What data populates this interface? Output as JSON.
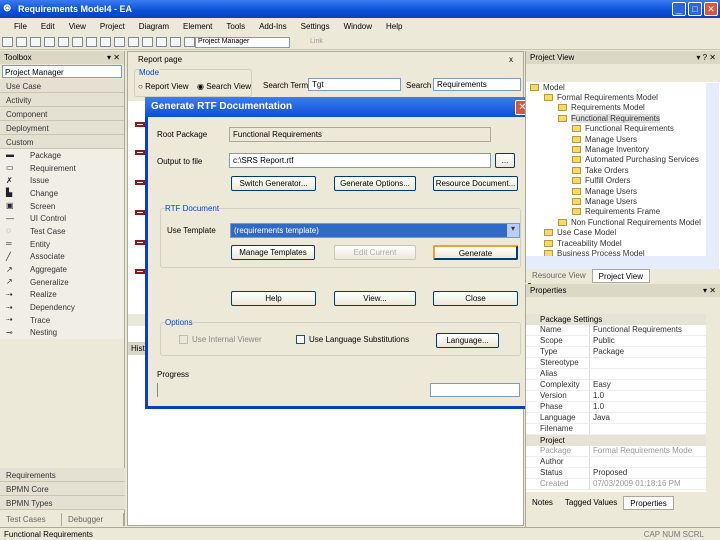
{
  "window": {
    "title": "Requirements Model4 - EA",
    "minimize": "_",
    "maximize": "□",
    "close": "✕"
  },
  "menu": [
    "File",
    "Edit",
    "View",
    "Project",
    "Diagram",
    "Element",
    "Tools",
    "Add-Ins",
    "Settings",
    "Window",
    "Help"
  ],
  "toolbar": {
    "perspective": "Project Manager",
    "link": "Link"
  },
  "toolbox": {
    "title": "Toolbox",
    "selector": "Project Manager",
    "categories": [
      "Use Case",
      "Activity",
      "Component",
      "Deployment",
      "Custom"
    ],
    "tools": [
      {
        "icon": "package-icon",
        "g": "▬",
        "label": "Package"
      },
      {
        "icon": "requirement-icon",
        "g": "▭",
        "label": "Requirement"
      },
      {
        "icon": "issue-icon",
        "g": "✗",
        "label": "Issue"
      },
      {
        "icon": "change-icon",
        "g": "▙",
        "label": "Change"
      },
      {
        "icon": "screen-icon",
        "g": "▣",
        "label": "Screen"
      },
      {
        "icon": "ui-control-icon",
        "g": "—",
        "label": "UI Control"
      },
      {
        "icon": "test-case-icon",
        "g": "◌",
        "label": "Test Case"
      },
      {
        "icon": "entity-icon",
        "g": "═",
        "label": "Entity"
      },
      {
        "icon": "associate-icon",
        "g": "╱",
        "label": "Associate"
      },
      {
        "icon": "aggregate-icon",
        "g": "↗",
        "label": "Aggregate"
      },
      {
        "icon": "generalize-icon",
        "g": "↗",
        "label": "Generalize"
      },
      {
        "icon": "realize-icon",
        "g": "⇢",
        "label": "Realize"
      },
      {
        "icon": "dependency-icon",
        "g": "⇢",
        "label": "Dependency"
      },
      {
        "icon": "trace-icon",
        "g": "⇢",
        "label": "Trace"
      },
      {
        "icon": "nesting-icon",
        "g": "⊸",
        "label": "Nesting"
      }
    ],
    "bottom_categories": [
      "Requirements",
      "BPMN Core",
      "BPMN Types"
    ],
    "tabs": [
      "Test Cases",
      "Debugger"
    ]
  },
  "report": {
    "tab": "Report page",
    "mode_label": "Mode",
    "report_view": "Report View",
    "search_view": "Search View",
    "search_term_label": "Search Term",
    "search_term": "Tgt",
    "search_label": "Search",
    "search_value": "Requirements",
    "history": "History"
  },
  "dialog": {
    "title": "Generate RTF Documentation",
    "root_label": "Root Package",
    "root_value": "Functional Requirements",
    "output_label": "Output to file",
    "output_value": "c:\\SRS Report.rtf",
    "browse": "...",
    "switch_gen": "Switch Generator...",
    "gen_options": "Generate Options...",
    "resource_doc": "Resource Document...",
    "rtf_group": "RTF Document",
    "template_label": "Use Template",
    "template_value": "(requirements template)",
    "manage_templates": "Manage Templates",
    "edit_current": "Edit Current",
    "generate": "Generate",
    "help": "Help",
    "view": "View...",
    "close": "Close",
    "options_group": "Options",
    "internal_viewer": "Use Internal Viewer",
    "lang_sub": "Use Language Substitutions",
    "language": "Language...",
    "progress": "Progress"
  },
  "project_view": {
    "title": "Project View",
    "tree": [
      {
        "d": 0,
        "t": "Model"
      },
      {
        "d": 1,
        "t": "Formal Requirements Model"
      },
      {
        "d": 2,
        "t": "Requirements Model"
      },
      {
        "d": 2,
        "t": "Functional Requirements",
        "sel": true
      },
      {
        "d": 3,
        "t": "Functional Requirements"
      },
      {
        "d": 3,
        "t": "Manage Users"
      },
      {
        "d": 3,
        "t": "Manage Inventory"
      },
      {
        "d": 3,
        "t": "Automated Purchasing Services"
      },
      {
        "d": 3,
        "t": "Take Orders"
      },
      {
        "d": 3,
        "t": "Fulfill Orders"
      },
      {
        "d": 3,
        "t": "Manage Users"
      },
      {
        "d": 3,
        "t": "Manage Users"
      },
      {
        "d": 3,
        "t": "Requirements Frame"
      },
      {
        "d": 2,
        "t": "Non Functional Requirements Model"
      },
      {
        "d": 1,
        "t": "Use Case Model"
      },
      {
        "d": 1,
        "t": "Traceability Model"
      },
      {
        "d": 1,
        "t": "Business Process Model"
      }
    ],
    "tabs": [
      "Resource View",
      "Project View"
    ]
  },
  "properties": {
    "title": "Properties",
    "group1": "Package Settings",
    "rows1": [
      [
        "Name",
        "Functional Requirements"
      ],
      [
        "Scope",
        "Public"
      ],
      [
        "Type",
        "Package"
      ],
      [
        "Stereotype",
        ""
      ],
      [
        "Alias",
        ""
      ],
      [
        "Complexity",
        "Easy"
      ],
      [
        "Version",
        "1.0"
      ],
      [
        "Phase",
        "1.0"
      ],
      [
        "Language",
        "Java"
      ],
      [
        "Filename",
        ""
      ]
    ],
    "group2": "Project",
    "rows2": [
      [
        "Package",
        "Formal Requirements Mode",
        true
      ],
      [
        "Author",
        "",
        false
      ],
      [
        "Status",
        "Proposed",
        false
      ],
      [
        "Created",
        "07/03/2009 01:18:16 PM",
        true
      ]
    ],
    "tabs": [
      "Notes",
      "Tagged Values",
      "Properties"
    ]
  },
  "status": {
    "left": "Functional Requirements",
    "right": "CAP NUM SCRL"
  }
}
